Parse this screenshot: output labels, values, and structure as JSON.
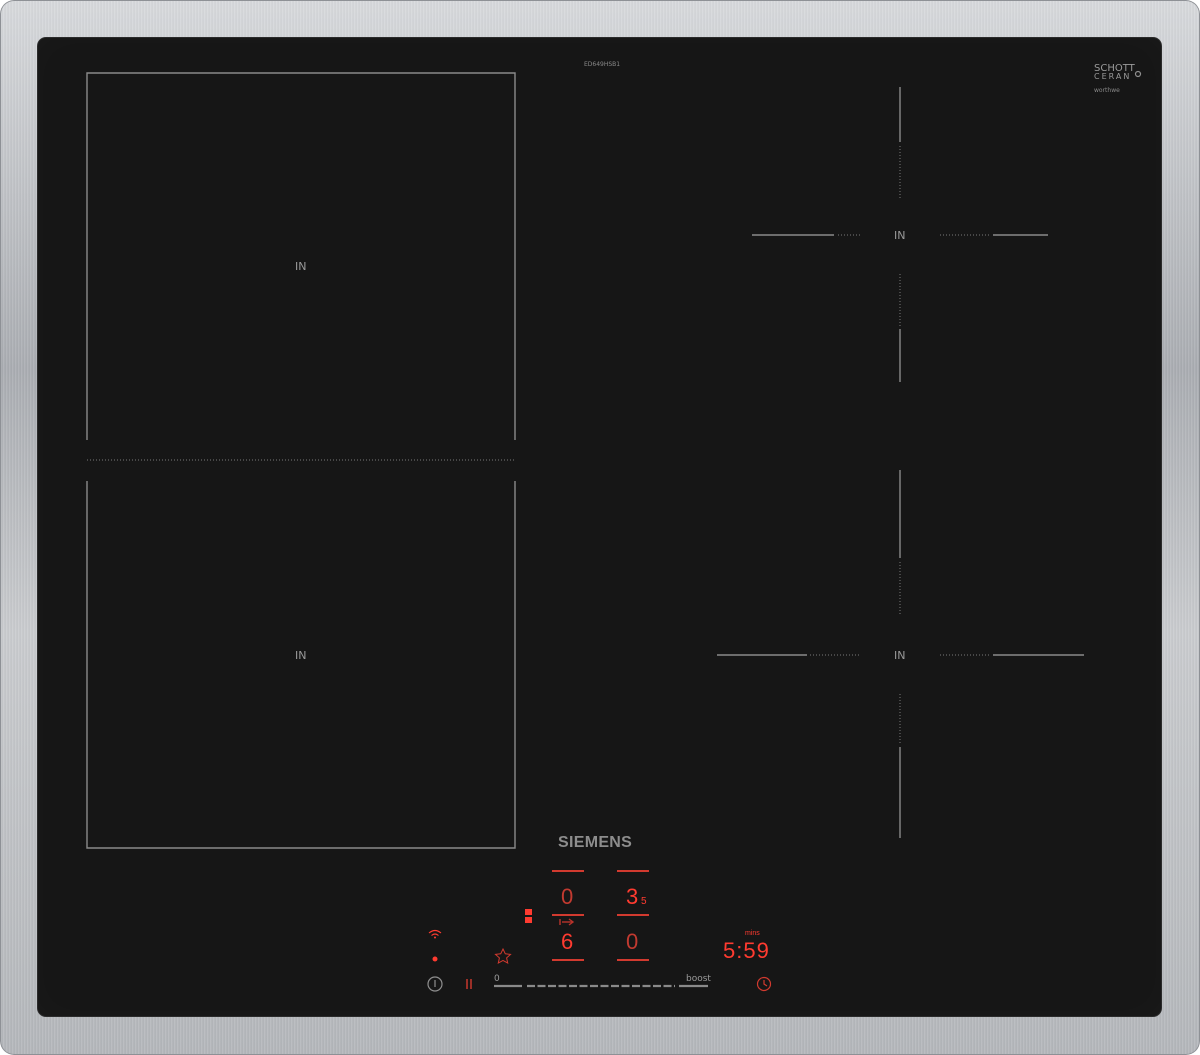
{
  "model_code": "ED649HSB1",
  "glass_logo": {
    "line1": "SCHOTT",
    "line2": "CERAN",
    "tagline": "worthwe"
  },
  "zones": {
    "left_top": {
      "label": "IN"
    },
    "left_bottom": {
      "label": "IN"
    },
    "right_top": {
      "label": "IN"
    },
    "right_bottom": {
      "label": "IN"
    }
  },
  "brand": "SIEMENS",
  "displays": {
    "zone_a": "0",
    "zone_b": "3",
    "zone_b_decimal": "5",
    "zone_c": "6",
    "zone_d": "0",
    "timer_unit": "mins",
    "timer_value": "5:59"
  },
  "control_panel": {
    "slider_min_label": "0",
    "slider_max_label": "boost"
  },
  "colors": {
    "glass": "#161616",
    "frame": "#b8bbbf",
    "led_red": "#ff3b30",
    "marking_gray": "#8a8a8a"
  },
  "icons": [
    "wifi-icon",
    "standby-dot-icon",
    "favourite-star-icon",
    "power-icon",
    "pause-icon",
    "timer-clock-icon",
    "flex-zone-icon",
    "transfer-arrow-icon"
  ]
}
